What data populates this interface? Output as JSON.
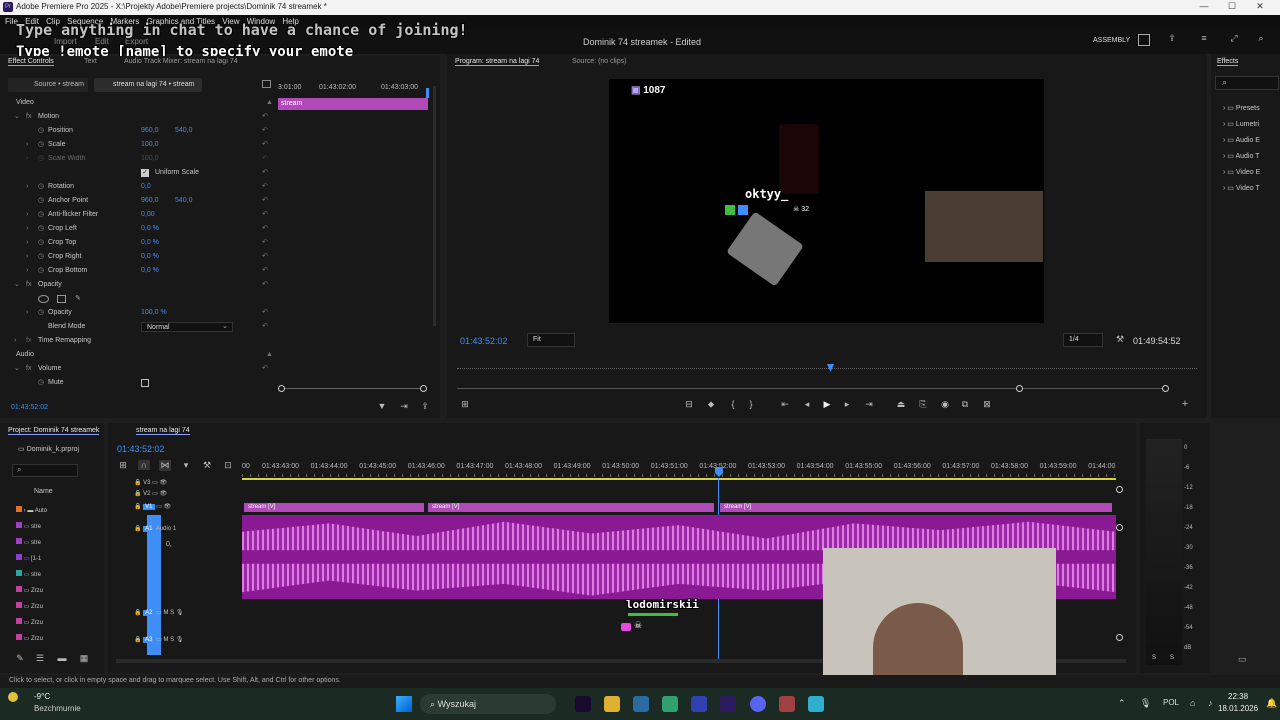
{
  "window": {
    "title": "Adobe Premiere Pro 2025 - X:\\Projekty Adobe\\Premiere projects\\Dominik 74 streamek *",
    "min": "—",
    "max": "☐",
    "close": "✕"
  },
  "menu": [
    "File",
    "Edit",
    "Clip",
    "Sequence",
    "Markers",
    "Graphics and Titles",
    "View",
    "Window",
    "Help"
  ],
  "chat_overlay": {
    "line1": "Type anything in chat to have a chance of joining!",
    "line2": "Type !emote [name] to specify your emote"
  },
  "header": {
    "project_title": "Dominik 74 streamek",
    "edited": "- Edited",
    "workspace": "ASSEMBLY",
    "ghost_tabs": [
      "Import",
      "Edit",
      "Export"
    ]
  },
  "left_panel": {
    "tabs": [
      "Effect Controls",
      "Text",
      "Audio Track Mixer: stream na lagi 74"
    ],
    "source_label": "Source • stream",
    "sequence_label": "stream na lagi 74 • stream",
    "ruler": [
      "3:01:00",
      "01:43:02:00",
      "01:43:03:00"
    ],
    "clip_label": "stream",
    "video_header": "Video",
    "motion": "Motion",
    "props": [
      {
        "name": "Position",
        "v1": "960,0",
        "v2": "540,0"
      },
      {
        "name": "Scale",
        "v1": "100,0",
        "v2": ""
      },
      {
        "name": "Scale Width",
        "v1": "100,0",
        "v2": ""
      },
      {
        "name": "Rotation",
        "v1": "0,0",
        "v2": ""
      },
      {
        "name": "Anchor Point",
        "v1": "960,0",
        "v2": "540,0"
      },
      {
        "name": "Anti-flicker Filter",
        "v1": "0,00",
        "v2": ""
      },
      {
        "name": "Crop Left",
        "v1": "0,0 %",
        "v2": ""
      },
      {
        "name": "Crop Top",
        "v1": "0,0 %",
        "v2": ""
      },
      {
        "name": "Crop Right",
        "v1": "0,0 %",
        "v2": ""
      },
      {
        "name": "Crop Bottom",
        "v1": "0,0 %",
        "v2": ""
      }
    ],
    "uniform_scale": "Uniform Scale",
    "opacity_header": "Opacity",
    "opacity_label": "Opacity",
    "opacity_value": "100,0 %",
    "blend_label": "Blend Mode",
    "blend_value": "Normal",
    "time_remap": "Time Remapping",
    "audio_header": "Audio",
    "volume": "Volume",
    "mute": "Mute",
    "timecode": "01:43:52:02"
  },
  "program": {
    "tab_program": "Program: stream na lagi 74",
    "tab_source": "Source: (no clips)",
    "viewer_count": "1087",
    "username": "oktyy_",
    "badge_count": "32",
    "timecode": "01:43:52:02",
    "fit": "Fit",
    "quality": "1/4",
    "duration": "01:49:54:52",
    "playhead_fraction": 0.5
  },
  "effects": {
    "tab": "Effects",
    "items": [
      "Presets",
      "Lumetri",
      "Audio E",
      "Audio T",
      "Video E",
      "Video T"
    ]
  },
  "project": {
    "tab": "Project: Dominik 74 streamek",
    "file": "Dominik_k.prproj",
    "name_header": "Name",
    "items": [
      "Auto",
      "stre",
      "stre",
      "[1-1",
      "stre",
      "Zrzu",
      "Zrzu",
      "Zrzu",
      "Zrzu"
    ],
    "colors": [
      "#e07030",
      "#a040c0",
      "#a040c0",
      "#9040d0",
      "#30a0a0",
      "#c040a0",
      "#c040a0",
      "#c040a0",
      "#c040a0"
    ]
  },
  "timeline": {
    "tab": "stream na lagi 74",
    "timecode": "01:43:52:02",
    "ruler": [
      "00",
      "01:43:43:00",
      "01:43:44:00",
      "01:43:45:00",
      "01:43:46:00",
      "01:43:47:00",
      "01:43:48:00",
      "01:43:49:00",
      "01:43:50:00",
      "01:43:51:00",
      "01:43:52:00",
      "01:43:53:00",
      "01:43:54:00",
      "01:43:55:00",
      "01:43:56:00",
      "01:43:57:00",
      "01:43:58:00",
      "01:43:59:00",
      "01:44:00"
    ],
    "tracks_v": [
      "V3",
      "V2",
      "V1"
    ],
    "tracks_a": [
      "A1",
      "A2",
      "A3"
    ],
    "audio1_label": "Audio 1",
    "a1_volume": "0,",
    "clips": [
      "stream [V]",
      "stream [V]",
      "stream [V]"
    ],
    "overlay_name": "lodomirskii",
    "meter_scale": [
      "0",
      "-6",
      "-12",
      "-18",
      "-24",
      "-30",
      "-36",
      "-42",
      "-48",
      "-54",
      "dB"
    ],
    "meter_bottom": [
      "S",
      "S"
    ]
  },
  "status": "Click to select, or click in empty space and drag to marquee select. Use Shift, Alt, and Ctrl for other options.",
  "taskbar": {
    "temp": "-9°C",
    "weather": "Bezchmurnie",
    "search": "Wyszukaj",
    "lang": "POL",
    "time": "22:38",
    "date": "18.01.2026"
  }
}
